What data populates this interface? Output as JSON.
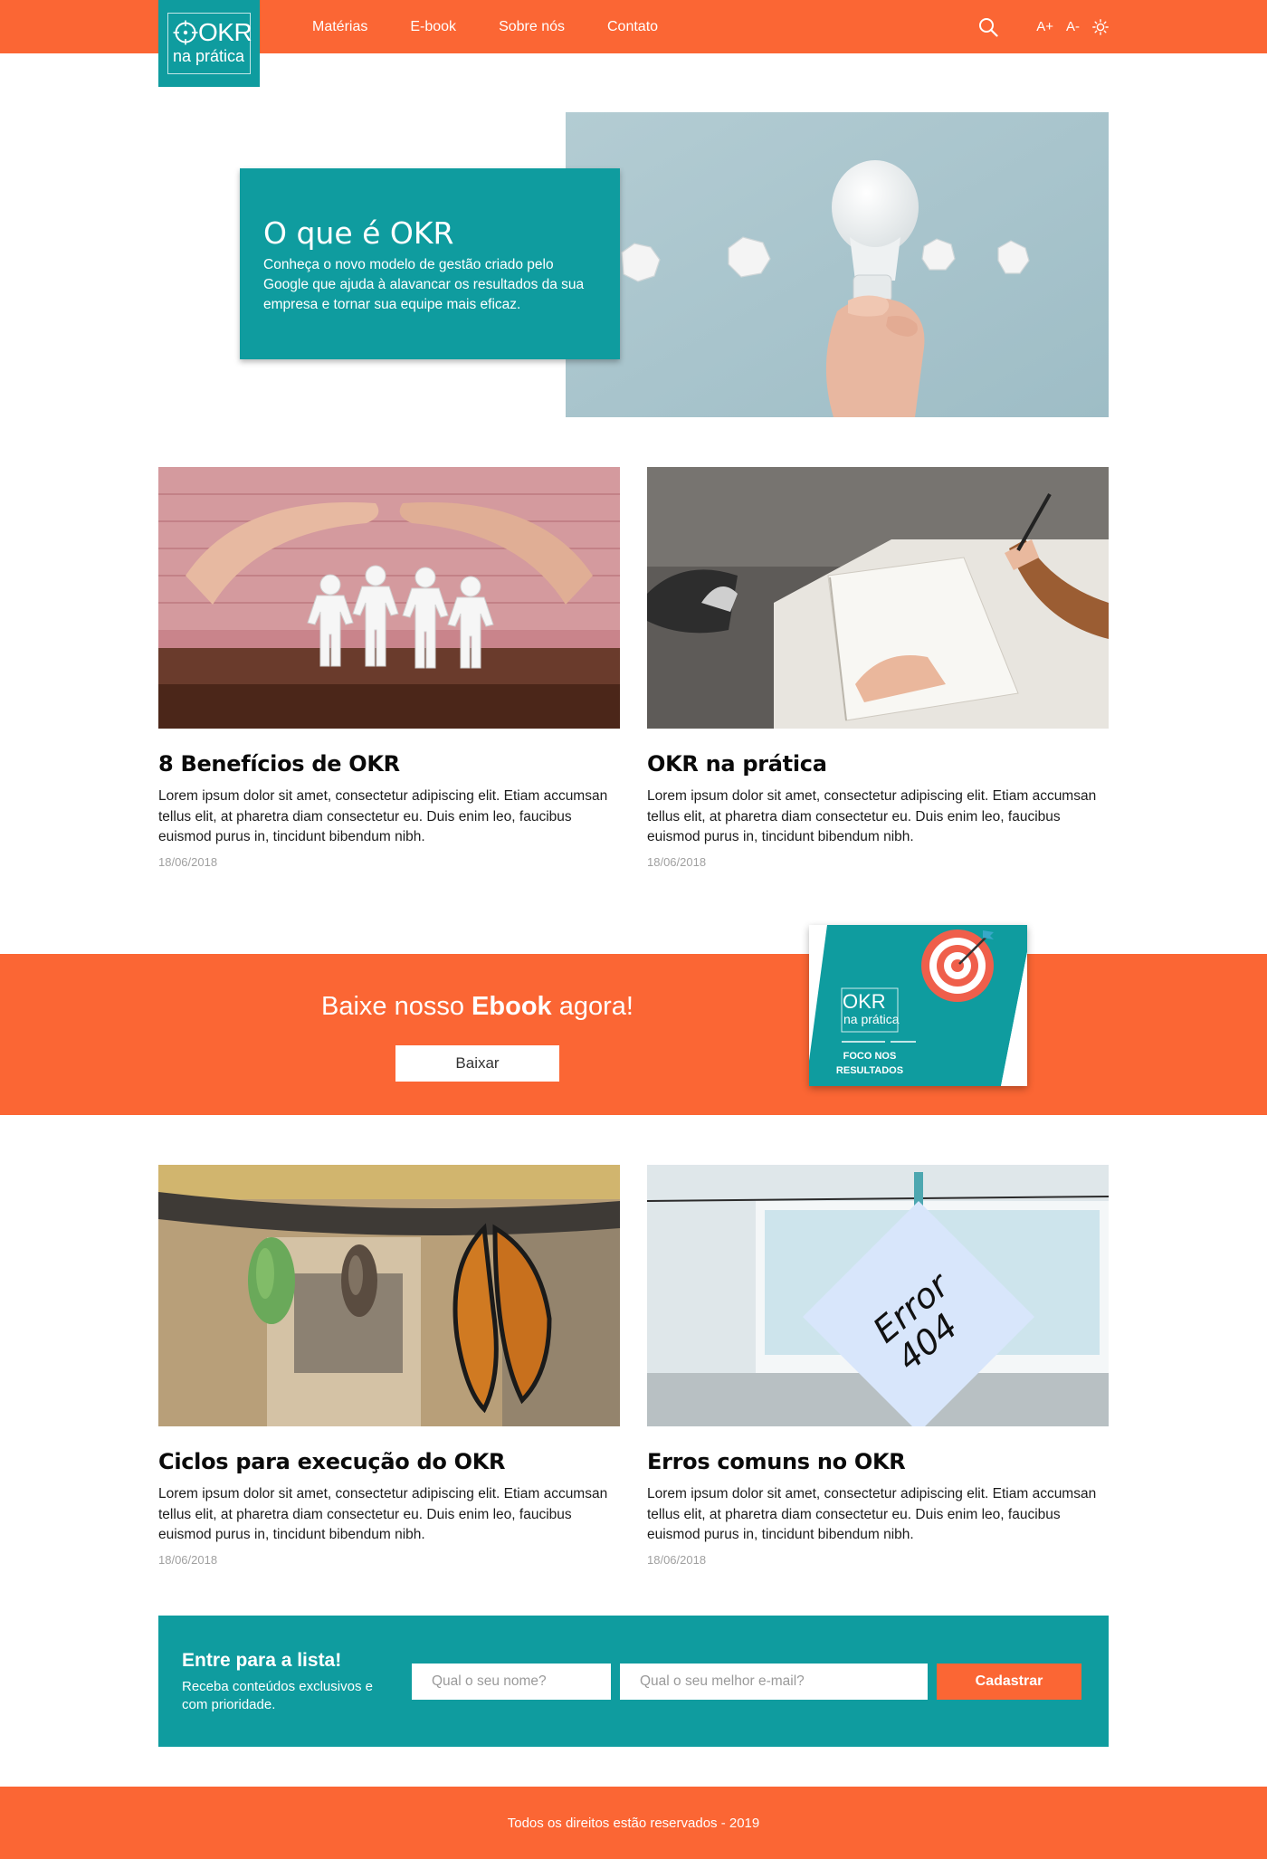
{
  "header": {
    "logo_main": "OKR",
    "logo_sub": "na prática",
    "nav": [
      "Matérias",
      "E-book",
      "Sobre nós",
      "Contato"
    ],
    "font_increase": "A+",
    "font_decrease": "A-"
  },
  "hero": {
    "title": "O que é OKR",
    "text": "Conheça o novo modelo de gestão criado pelo Google que ajuda à alavancar os resultados da sua empresa e tornar sua equipe mais eficaz."
  },
  "articles": [
    {
      "title": "8 Benefícios de OKR",
      "text": "Lorem ipsum dolor sit amet, consectetur adipiscing elit. Etiam accumsan tellus elit, at pharetra diam consectetur eu. Duis enim leo, faucibus euismod purus in, tincidunt bibendum nibh.",
      "date": "18/06/2018"
    },
    {
      "title": "OKR na prática",
      "text": "Lorem ipsum dolor sit amet, consectetur adipiscing elit. Etiam accumsan tellus elit, at pharetra diam consectetur eu. Duis enim leo, faucibus euismod purus in, tincidunt bibendum nibh.",
      "date": "18/06/2018"
    },
    {
      "title": "Ciclos para execução do OKR",
      "text": "Lorem ipsum dolor sit amet, consectetur adipiscing elit. Etiam accumsan tellus elit, at pharetra diam consectetur eu. Duis enim leo, faucibus euismod purus in, tincidunt bibendum nibh.",
      "date": "18/06/2018"
    },
    {
      "title": "Erros comuns no OKR",
      "text": "Lorem ipsum dolor sit amet, consectetur adipiscing elit. Etiam accumsan tellus elit, at pharetra diam consectetur eu. Duis enim leo, faucibus euismod purus in, tincidunt bibendum nibh.",
      "date": "18/06/2018",
      "note_line1": "Error",
      "note_line2": "404"
    }
  ],
  "ebook_banner": {
    "heading_pre": "Baixe nosso ",
    "heading_bold": "Ebook",
    "heading_post": " agora!",
    "button": "Baixar",
    "cover_title": "OKR",
    "cover_sub": "na prática",
    "cover_line1": "FOCO NOS",
    "cover_line2": "RESULTADOS"
  },
  "newsletter": {
    "title": "Entre para a lista!",
    "subtitle": "Receba conteúdos exclusivos e com prioridade.",
    "name_placeholder": "Qual o seu nome?",
    "email_placeholder": "Qual o seu melhor e-mail?",
    "button": "Cadastrar"
  },
  "footer": {
    "text": "Todos os direitos estão reservados - 2019"
  },
  "colors": {
    "orange": "#fb6634",
    "teal": "#0f9c9f",
    "white": "#ffffff"
  },
  "icons": [
    "search-icon",
    "sun-icon",
    "target-icon"
  ]
}
